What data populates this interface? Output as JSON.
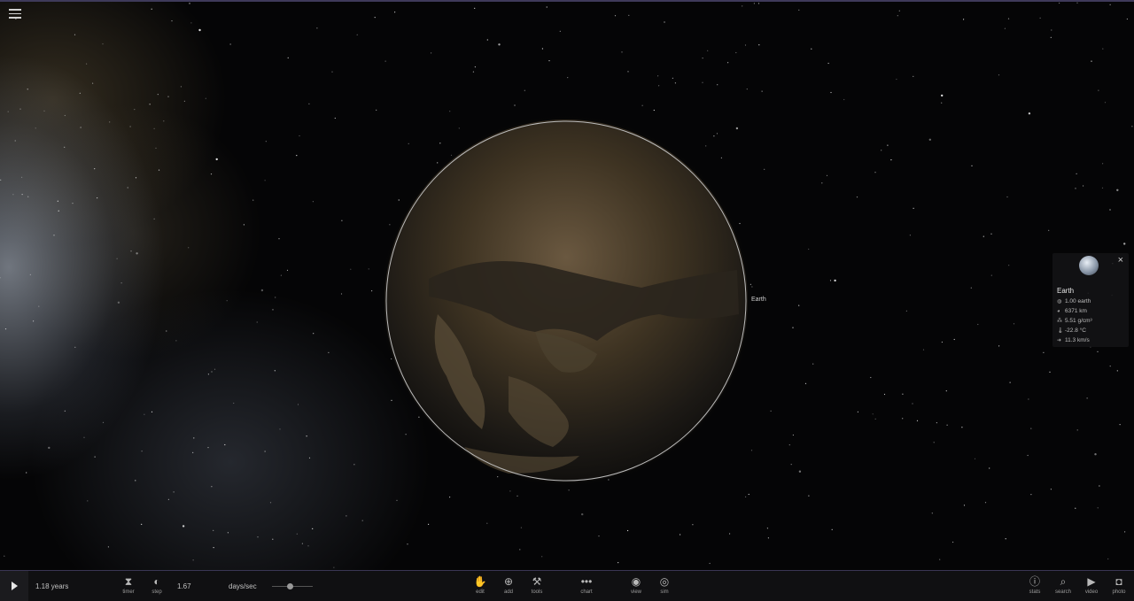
{
  "app": {
    "menu_icon": "hamburger-icon"
  },
  "scene": {
    "body_label": "Earth"
  },
  "info_panel": {
    "close": "×",
    "name": "Earth",
    "stats": [
      {
        "icon": "mass-icon",
        "glyph": "◍",
        "value": "1.00 earth"
      },
      {
        "icon": "radius-icon",
        "glyph": "◕",
        "value": "6371 km"
      },
      {
        "icon": "density-icon",
        "glyph": "⁂",
        "value": "5.51 g/cm³"
      },
      {
        "icon": "temperature-icon",
        "glyph": "🌡",
        "value": "-22.8 °C"
      },
      {
        "icon": "velocity-icon",
        "glyph": "➜",
        "value": "11.3 km/s"
      }
    ]
  },
  "bottom_bar": {
    "play_icon": "play-icon",
    "time_elapsed": "1.18 years",
    "timer_label": "timer",
    "step_label": "step",
    "speed_value": "1.67",
    "speed_unit": "days/sec",
    "speed_slider_level": 0.45,
    "tools": [
      {
        "label": "edit",
        "icon": "hand-icon",
        "glyph": "✋"
      },
      {
        "label": "add",
        "icon": "add-circle-icon",
        "glyph": "⊕"
      },
      {
        "label": "tools",
        "icon": "tools-icon",
        "glyph": "⚒"
      },
      {
        "label": "chart",
        "icon": "chart-icon",
        "glyph": "•••"
      },
      {
        "label": "view",
        "icon": "eye-icon",
        "glyph": "◉"
      },
      {
        "label": "sim",
        "icon": "sim-icon",
        "glyph": "◎"
      }
    ],
    "right_tools": [
      {
        "label": "stats",
        "icon": "info-icon",
        "glyph": "ⓘ"
      },
      {
        "label": "search",
        "icon": "search-icon",
        "glyph": "⌕"
      },
      {
        "label": "video",
        "icon": "video-camera-icon",
        "glyph": "▶"
      },
      {
        "label": "photo",
        "icon": "camera-icon",
        "glyph": "◘"
      }
    ]
  }
}
